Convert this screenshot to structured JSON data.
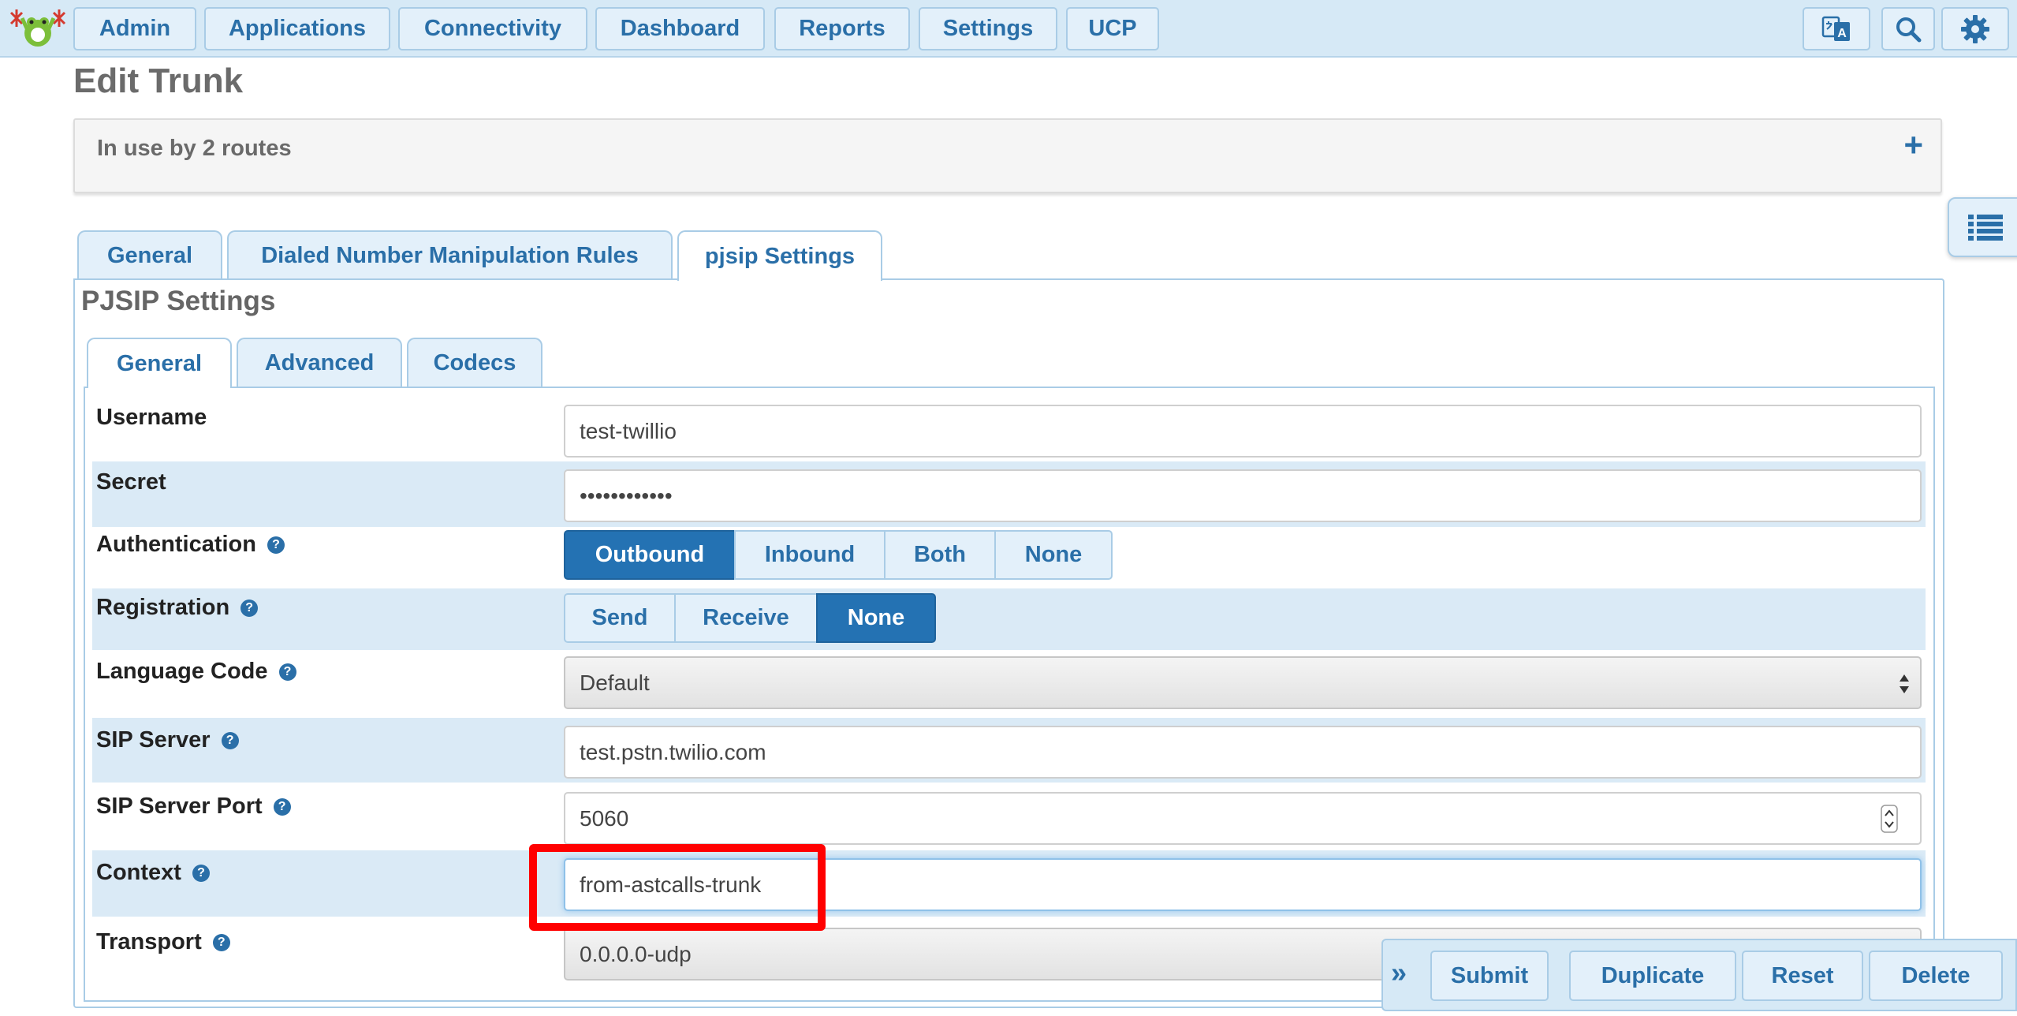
{
  "nav": {
    "items": [
      "Admin",
      "Applications",
      "Connectivity",
      "Dashboard",
      "Reports",
      "Settings",
      "UCP"
    ],
    "icons": [
      "translate-icon",
      "search-icon",
      "gear-icon"
    ]
  },
  "page": {
    "title": "Edit Trunk",
    "in_use": "In use by 2 routes",
    "expand_symbol": "+"
  },
  "tabs": {
    "main": [
      "General",
      "Dialed Number Manipulation Rules",
      "pjsip Settings"
    ],
    "main_active": "pjsip Settings",
    "section_title": "PJSIP Settings",
    "sub": [
      "General",
      "Advanced",
      "Codecs"
    ],
    "sub_active": "General"
  },
  "fields": {
    "username": {
      "label": "Username",
      "value": "test-twillio"
    },
    "secret": {
      "label": "Secret",
      "value": "••••••••••••"
    },
    "authentication": {
      "label": "Authentication",
      "options": [
        "Outbound",
        "Inbound",
        "Both",
        "None"
      ],
      "selected": "Outbound"
    },
    "registration": {
      "label": "Registration",
      "options": [
        "Send",
        "Receive",
        "None"
      ],
      "selected": "None"
    },
    "language": {
      "label": "Language Code",
      "value": "Default"
    },
    "sip_server": {
      "label": "SIP Server",
      "value": "test.pstn.twilio.com"
    },
    "sip_port": {
      "label": "SIP Server Port",
      "value": "5060"
    },
    "context": {
      "label": "Context",
      "value": "from-astcalls-trunk"
    },
    "transport": {
      "label": "Transport",
      "value": "0.0.0.0-udp"
    }
  },
  "actions": {
    "collapse": "»",
    "submit": "Submit",
    "duplicate": "Duplicate",
    "reset": "Reset",
    "delete": "Delete"
  },
  "colors": {
    "accent": "#2a6fa8",
    "selected": "#2472b3",
    "nav_bg": "#d6e9f6",
    "highlight": "#ff0000"
  }
}
